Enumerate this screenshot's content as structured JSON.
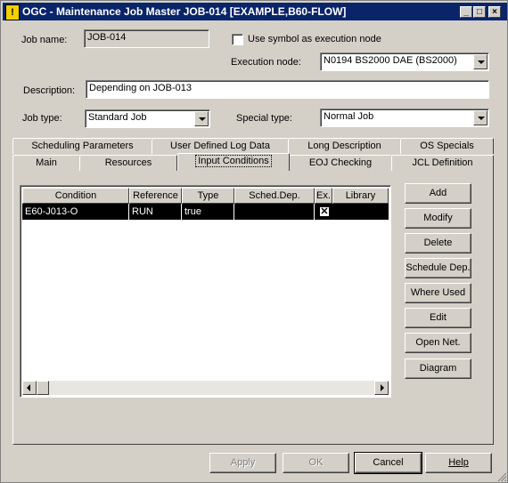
{
  "window": {
    "title": "OGC - Maintenance Job Master JOB-014 [EXAMPLE,B60-FLOW]",
    "app_icon": "!",
    "minimize_glyph": "_",
    "maximize_glyph": "□",
    "close_glyph": "×"
  },
  "form": {
    "job_name_label": "Job name:",
    "job_name_value": "JOB-014",
    "use_symbol_label": "Use symbol as execution node",
    "use_symbol_checked": false,
    "execution_node_label": "Execution node:",
    "execution_node_value": "N0194  BS2000 DAE (BS2000)",
    "description_label": "Description:",
    "description_value": "Depending on JOB-013",
    "job_type_label": "Job type:",
    "job_type_value": "Standard Job",
    "special_type_label": "Special type:",
    "special_type_value": "Normal Job"
  },
  "tabs": {
    "row1": [
      "Scheduling Parameters",
      "User Defined Log Data",
      "Long Description",
      "OS Specials"
    ],
    "row2": [
      "Main",
      "Resources",
      "Input Conditions",
      "EOJ Checking",
      "JCL Definition"
    ],
    "active": "Input Conditions"
  },
  "table": {
    "columns": [
      "Condition",
      "Reference",
      "Type",
      "Sched.Dep.",
      "Ex.",
      "Library"
    ],
    "rows": [
      {
        "condition": "E60-J013-O",
        "reference": "RUN",
        "type": "true",
        "sched_dep": "",
        "ex": "☒",
        "library": ""
      }
    ]
  },
  "side_buttons": {
    "add": "Add",
    "modify": "Modify",
    "delete": "Delete",
    "schedule_dep": "Schedule Dep.",
    "where_used": "Where Used",
    "edit": "Edit",
    "open_net": "Open Net.",
    "diagram": "Diagram"
  },
  "footer": {
    "apply": "Apply",
    "ok": "OK",
    "cancel": "Cancel",
    "help": "Help"
  },
  "colors": {
    "titlebar": "#0a246a",
    "face": "#d4d0c8",
    "selection": "#000000"
  }
}
